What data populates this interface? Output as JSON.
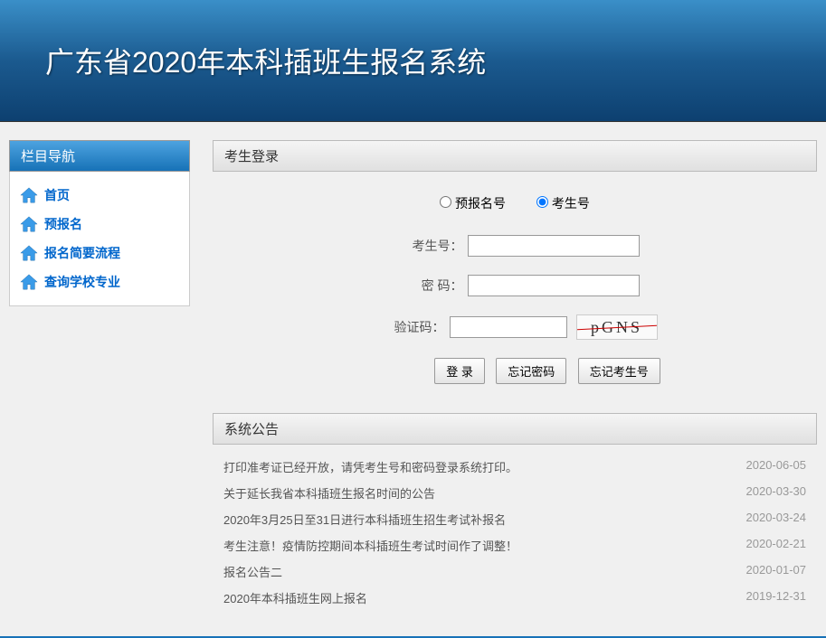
{
  "header": {
    "title": "广东省2020年本科插班生报名系统"
  },
  "sidebar": {
    "title": "栏目导航",
    "items": [
      {
        "label": "首页"
      },
      {
        "label": "预报名"
      },
      {
        "label": "报名简要流程"
      },
      {
        "label": "查询学校专业"
      }
    ]
  },
  "login": {
    "panel_title": "考生登录",
    "radio_pre": "预报名号",
    "radio_exam": "考生号",
    "label_id": "考生号：",
    "label_password": "密  码：",
    "label_captcha": "验证码：",
    "captcha_text": "pGNS",
    "btn_login": "登 录",
    "btn_forgot_pwd": "忘记密码",
    "btn_forgot_id": "忘记考生号"
  },
  "notices": {
    "panel_title": "系统公告",
    "items": [
      {
        "text": "打印准考证已经开放，请凭考生号和密码登录系统打印。",
        "date": "2020-06-05"
      },
      {
        "text": "关于延长我省本科插班生报名时间的公告",
        "date": "2020-03-30"
      },
      {
        "text": "2020年3月25日至31日进行本科插班生招生考试补报名",
        "date": "2020-03-24"
      },
      {
        "text": "考生注意！疫情防控期间本科插班生考试时间作了调整！",
        "date": "2020-02-21"
      },
      {
        "text": "报名公告二",
        "date": "2020-01-07"
      },
      {
        "text": "2020年本科插班生网上报名",
        "date": "2019-12-31"
      }
    ]
  }
}
